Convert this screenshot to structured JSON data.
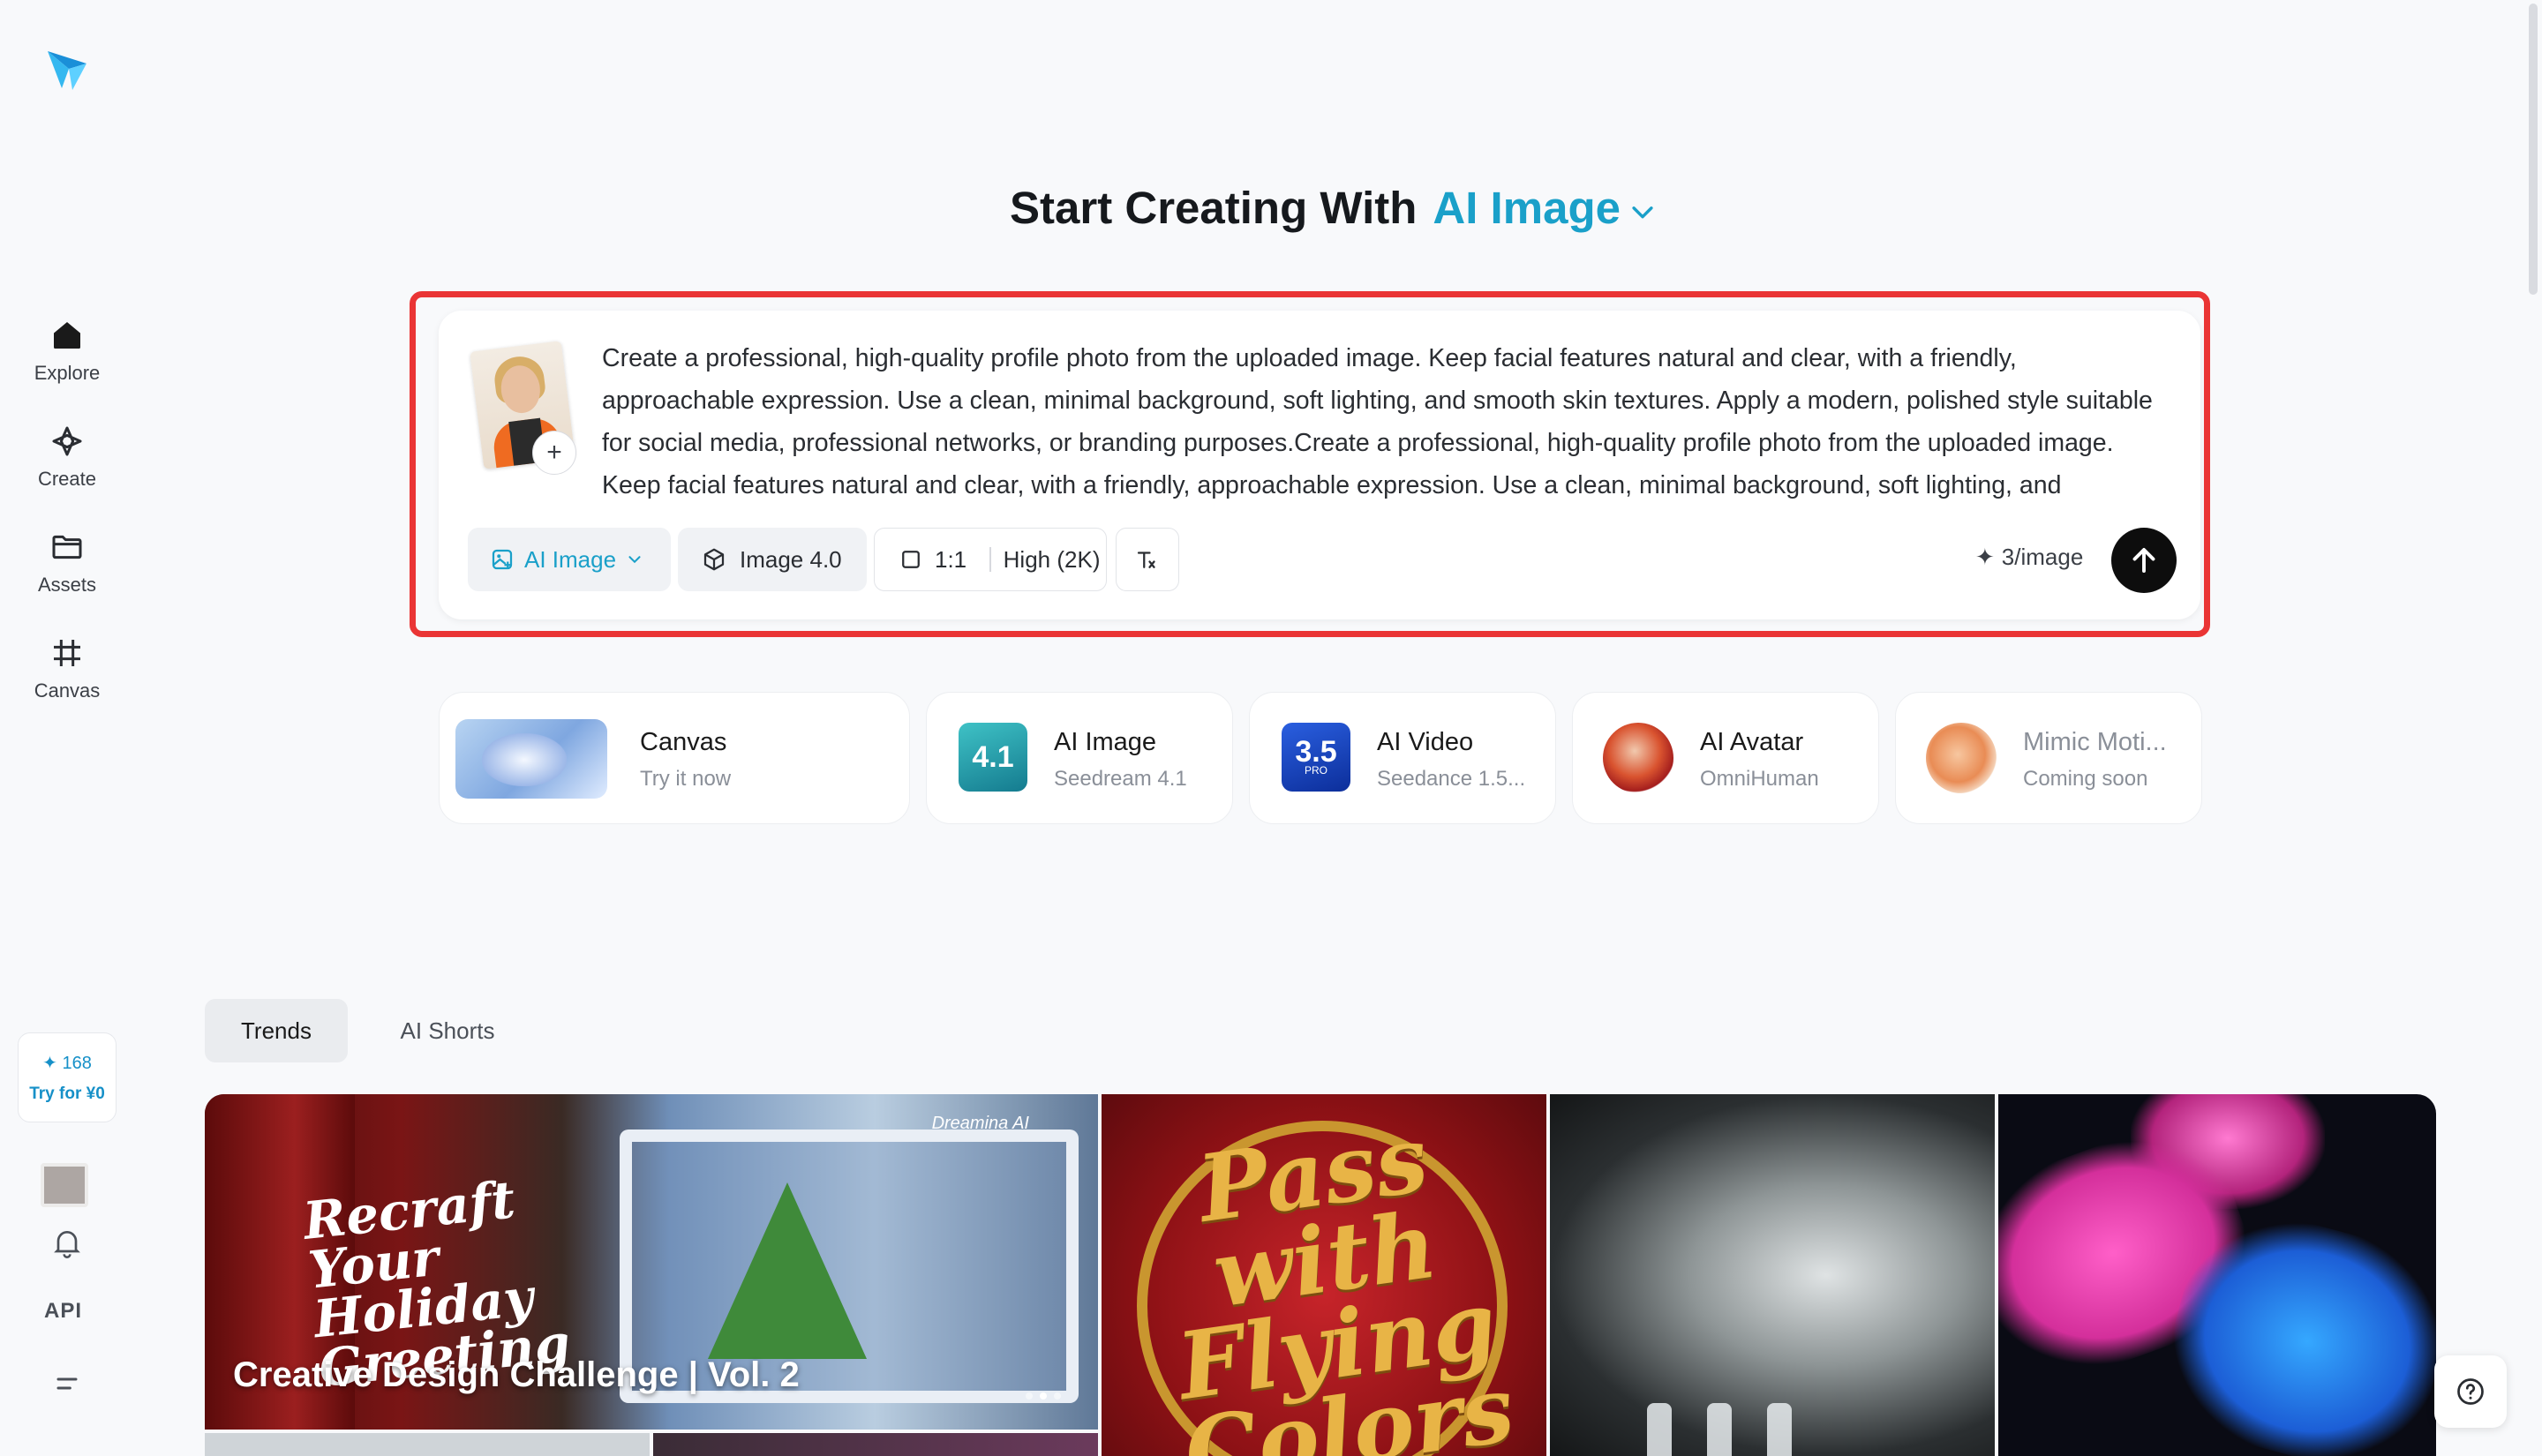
{
  "sidebar": {
    "items": [
      {
        "label": "Explore",
        "icon": "home-icon"
      },
      {
        "label": "Create",
        "icon": "sparkle-icon"
      },
      {
        "label": "Assets",
        "icon": "folder-icon"
      },
      {
        "label": "Canvas",
        "icon": "frame-icon"
      }
    ],
    "credits": {
      "amount": "168",
      "cta": "Try for ¥0"
    },
    "api_label": "API"
  },
  "heading": {
    "prefix": "Start Creating With",
    "mode": "AI Image"
  },
  "prompt": {
    "text": "Create a professional, high-quality profile photo from the uploaded image. Keep facial features natural and clear, with a friendly, approachable expression. Use a clean, minimal background, soft lighting, and smooth skin textures. Apply a modern, polished style suitable for social media, professional networks, or branding purposes.Create a professional, high-quality profile photo from the uploaded image. Keep facial features natural and clear, with a friendly, approachable expression. Use a clean, minimal background, soft lighting, and",
    "toolbar": {
      "mode": "AI Image",
      "model": "Image 4.0",
      "ratio": "1:1",
      "quality": "High (2K)",
      "cost": "3/image"
    }
  },
  "features": [
    {
      "title": "Canvas",
      "subtitle": "Try it now"
    },
    {
      "title": "AI Image",
      "subtitle": "Seedream 4.1",
      "badge": "4.1"
    },
    {
      "title": "AI Video",
      "subtitle": "Seedance 1.5...",
      "badge": "3.5",
      "badge_sub": "PRO"
    },
    {
      "title": "AI Avatar",
      "subtitle": "OmniHuman"
    },
    {
      "title": "Mimic Moti...",
      "subtitle": "Coming soon"
    }
  ],
  "tabs": [
    {
      "label": "Trends",
      "active": true
    },
    {
      "label": "AI Shorts",
      "active": false
    }
  ],
  "gallery": {
    "hero": {
      "script": "Recraft Your Holiday Greeting",
      "brand": "Dreamina AI",
      "caption": "Creative Design Challenge | Vol. 2"
    },
    "pass": {
      "text": "Pass with Flying Colors"
    }
  },
  "colors": {
    "accent": "#1aa0c9",
    "highlight": "#ea3535",
    "send": "#0d0d0d"
  }
}
